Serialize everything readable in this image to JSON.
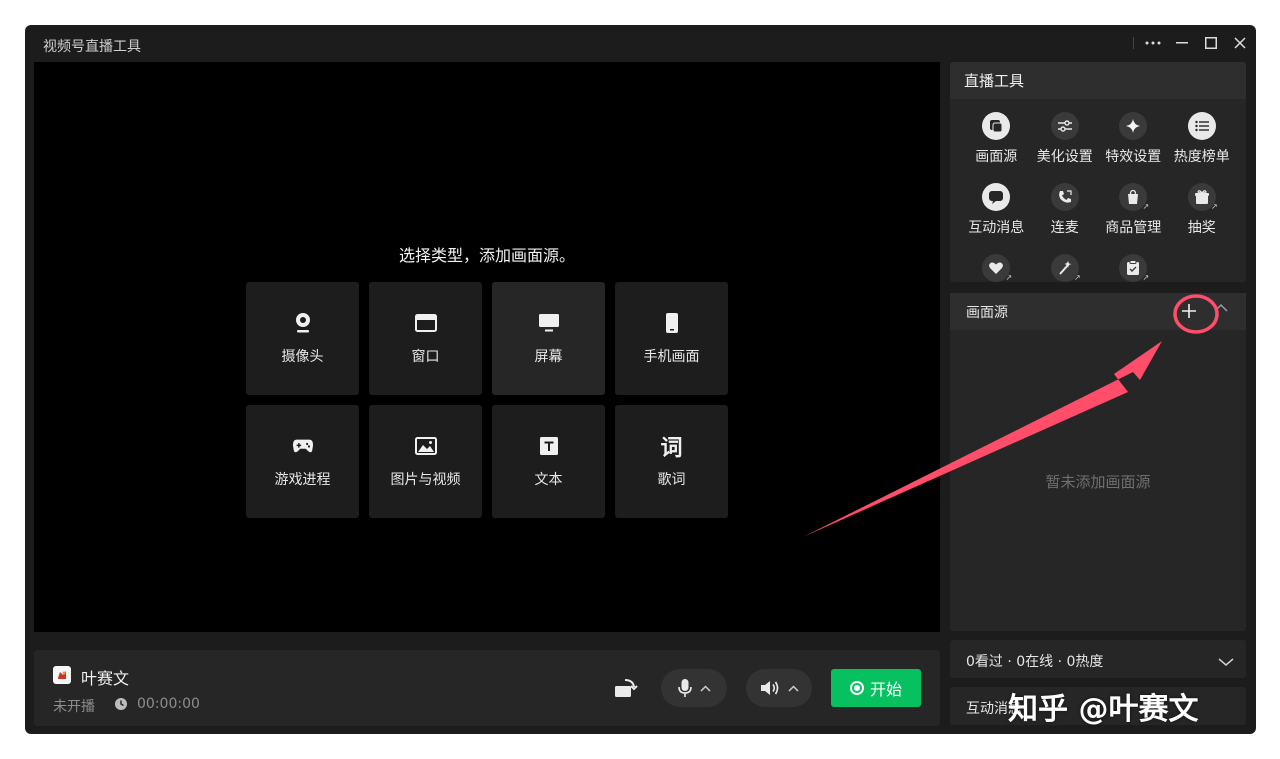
{
  "window": {
    "title": "视频号直播工具"
  },
  "stage": {
    "hint": "选择类型，添加画面源。",
    "sources": [
      {
        "label": "摄像头",
        "icon": "camera-icon"
      },
      {
        "label": "窗口",
        "icon": "window-icon"
      },
      {
        "label": "屏幕",
        "icon": "monitor-icon"
      },
      {
        "label": "手机画面",
        "icon": "phone-icon"
      },
      {
        "label": "游戏进程",
        "icon": "gamepad-icon"
      },
      {
        "label": "图片与视频",
        "icon": "image-icon"
      },
      {
        "label": "文本",
        "icon": "text-icon"
      },
      {
        "label": "歌词",
        "icon": "lyrics-icon",
        "glyph": "词"
      }
    ]
  },
  "bottombar": {
    "username": "叶赛文",
    "status": "未开播",
    "timer": "00:00:00",
    "start_label": "开始"
  },
  "tools": {
    "header": "直播工具",
    "items": [
      {
        "label": "画面源",
        "icon": "source-icon"
      },
      {
        "label": "美化设置",
        "icon": "sliders-icon"
      },
      {
        "label": "特效设置",
        "icon": "sparkle-icon"
      },
      {
        "label": "热度榜单",
        "icon": "list-icon"
      },
      {
        "label": "互动消息",
        "icon": "chat-icon"
      },
      {
        "label": "连麦",
        "icon": "call-icon"
      },
      {
        "label": "商品管理",
        "icon": "shopping-bag-icon"
      },
      {
        "label": "抽奖",
        "icon": "gift-icon"
      }
    ]
  },
  "sources_panel": {
    "header": "画面源",
    "empty": "暂未添加画面源"
  },
  "stats": {
    "text": "0看过 · 0在线 · 0热度"
  },
  "messages": {
    "label": "互动消息"
  },
  "watermark": "知乎 @叶赛文",
  "colors": {
    "accent_green": "#07c160",
    "annotation_red": "#ff4d6a"
  }
}
